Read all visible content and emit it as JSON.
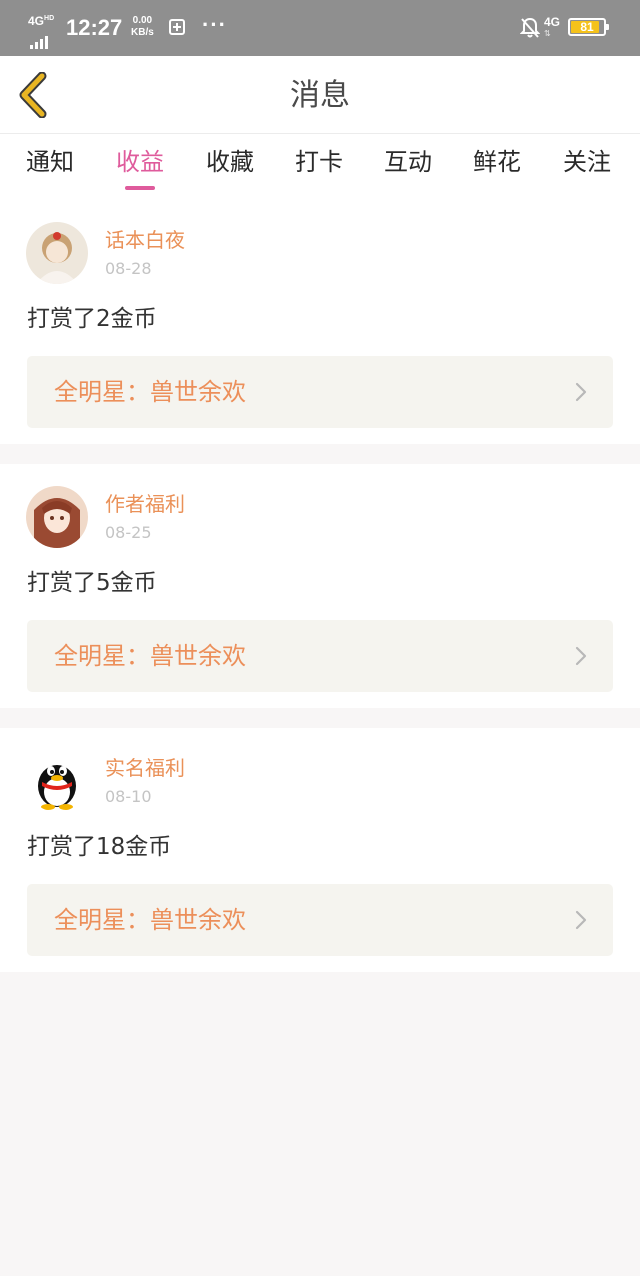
{
  "status_bar": {
    "network_label": "4G",
    "network_sup": "HD",
    "time": "12:27",
    "speed_value": "0.00",
    "speed_unit": "KB/s",
    "more": "···",
    "signal_label": "4G",
    "battery": "81"
  },
  "header": {
    "title": "消息",
    "back_icon": "chevron-left-icon"
  },
  "tabs": [
    {
      "label": "通知",
      "active": false
    },
    {
      "label": "收益",
      "active": true
    },
    {
      "label": "收藏",
      "active": false
    },
    {
      "label": "打卡",
      "active": false
    },
    {
      "label": "互动",
      "active": false
    },
    {
      "label": "鲜花",
      "active": false
    },
    {
      "label": "关注",
      "active": false
    }
  ],
  "messages": [
    {
      "name": "话本白夜",
      "date": "08-28",
      "text": "打赏了2金币",
      "book": "全明星：兽世余欢"
    },
    {
      "name": "作者福利",
      "date": "08-25",
      "text": "打赏了5金币",
      "book": "全明星：兽世余欢"
    },
    {
      "name": "实名福利",
      "date": "08-10",
      "text": "打赏了18金币",
      "book": "全明星：兽世余欢"
    }
  ],
  "colors": {
    "accent": "#df5b9c",
    "name_orange": "#ea9158",
    "book_bg": "#f5f4ef",
    "page_bg": "#f8f6f6",
    "back_icon": "#e8b523"
  }
}
